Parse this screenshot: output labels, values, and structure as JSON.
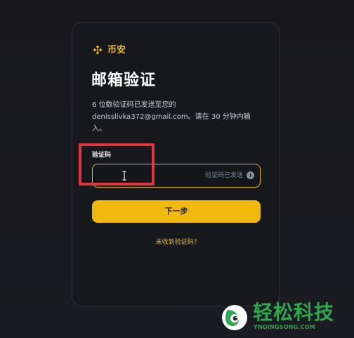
{
  "brand": {
    "name": "币安",
    "logo_icon": "binance-logo-icon",
    "color": "#f0b90b"
  },
  "page": {
    "title": "邮箱验证",
    "description": "6 位数验证码已发送至您的 denisslivka372@gmail.com。请在 30 分钟内输入。"
  },
  "form": {
    "label": "验证码",
    "input_value": "",
    "input_hint": "验证码已发送",
    "info_icon": "info-icon",
    "submit_label": "下一步",
    "help_link": "未收到验证码?"
  },
  "overlay": {
    "highlight_color": "#e2353d"
  },
  "watermark": {
    "title": "轻松科技",
    "subtitle": "YNQINGSONG.COM",
    "logo_icon": "leaf-logo-icon",
    "color": "#2fa84f"
  }
}
